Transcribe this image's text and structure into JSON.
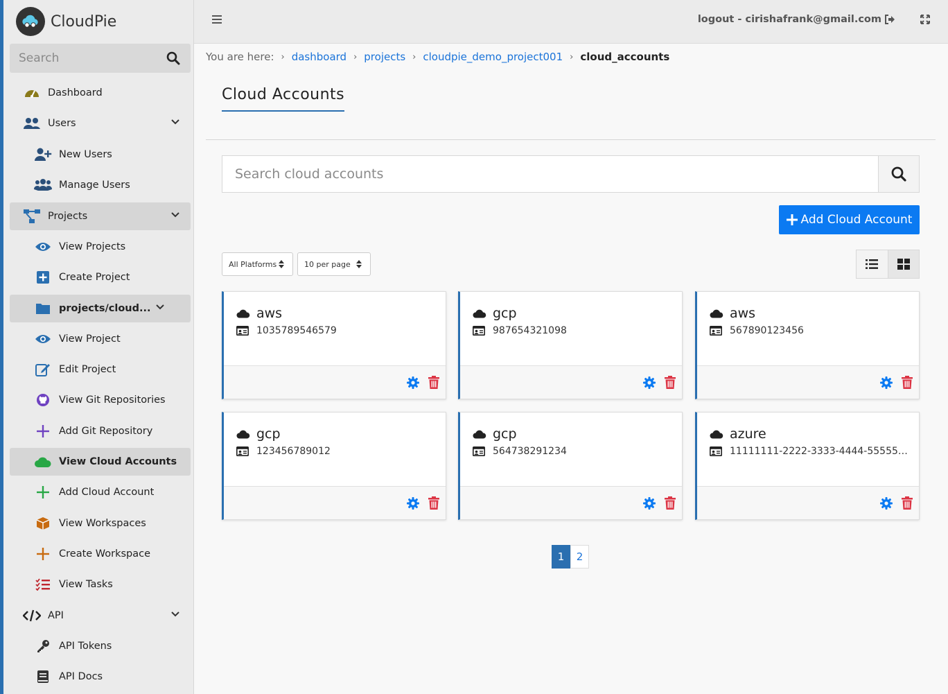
{
  "app": {
    "name": "CloudPie"
  },
  "sidebar": {
    "search_placeholder": "Search",
    "items": [
      {
        "label": "Dashboard",
        "icon": "tachometer-icon",
        "color": "#8a7a1a"
      },
      {
        "label": "Users",
        "icon": "users-icon",
        "color": "#2a4f7a"
      },
      {
        "label": "New Users",
        "icon": "user-plus-icon",
        "color": "#2a4f7a"
      },
      {
        "label": "Manage Users",
        "icon": "users-cog-icon",
        "color": "#2a4f7a"
      },
      {
        "label": "Projects",
        "icon": "project-diagram-icon",
        "color": "#2a6fb0"
      },
      {
        "label": "View Projects",
        "icon": "eye-icon",
        "color": "#2a6fb0"
      },
      {
        "label": "Create Project",
        "icon": "plus-square-icon",
        "color": "#2a6fb0"
      },
      {
        "label": "projects/cloud...",
        "icon": "folder-icon",
        "color": "#2a6fb0"
      },
      {
        "label": "View Project",
        "icon": "eye-icon",
        "color": "#2a6fb0"
      },
      {
        "label": "Edit Project",
        "icon": "edit-icon",
        "color": "#2a6fb0"
      },
      {
        "label": "View Git Repositories",
        "icon": "github-icon",
        "color": "#6f42c1"
      },
      {
        "label": "Add Git Repository",
        "icon": "plus-icon",
        "color": "#6f42c1"
      },
      {
        "label": "View Cloud Accounts",
        "icon": "cloud-icon",
        "color": "#28a745"
      },
      {
        "label": "Add Cloud Account",
        "icon": "plus-icon",
        "color": "#28a745"
      },
      {
        "label": "View Workspaces",
        "icon": "cube-icon",
        "color": "#c86b10"
      },
      {
        "label": "Create Workspace",
        "icon": "plus-icon",
        "color": "#c86b10"
      },
      {
        "label": "View Tasks",
        "icon": "tasks-icon",
        "color": "#c0282f"
      },
      {
        "label": "API",
        "icon": "code-icon",
        "color": "#222222"
      },
      {
        "label": "API Tokens",
        "icon": "key-icon",
        "color": "#333333"
      },
      {
        "label": "API Docs",
        "icon": "book-icon",
        "color": "#333333"
      }
    ]
  },
  "topbar": {
    "logout_label": "logout - cirishafrank@gmail.com"
  },
  "breadcrumb": {
    "prefix": "You are here:",
    "items": [
      "dashboard",
      "projects",
      "cloudpie_demo_project001"
    ],
    "current": "cloud_accounts"
  },
  "main": {
    "title": "Cloud Accounts",
    "search_placeholder": "Search cloud accounts",
    "add_button": "Add Cloud Account",
    "platform_filter": "All Platforms",
    "per_page": "10 per page",
    "accounts": [
      {
        "platform": "aws",
        "account_id": "1035789546579"
      },
      {
        "platform": "gcp",
        "account_id": "987654321098"
      },
      {
        "platform": "aws",
        "account_id": "567890123456"
      },
      {
        "platform": "gcp",
        "account_id": "123456789012"
      },
      {
        "platform": "gcp",
        "account_id": "564738291234"
      },
      {
        "platform": "azure",
        "account_id": "11111111-2222-3333-4444-55555555..."
      }
    ],
    "pages": [
      "1",
      "2"
    ]
  },
  "colors": {
    "primary": "#0b7af2",
    "accent": "#2a6fb0",
    "danger": "#dc3545"
  }
}
